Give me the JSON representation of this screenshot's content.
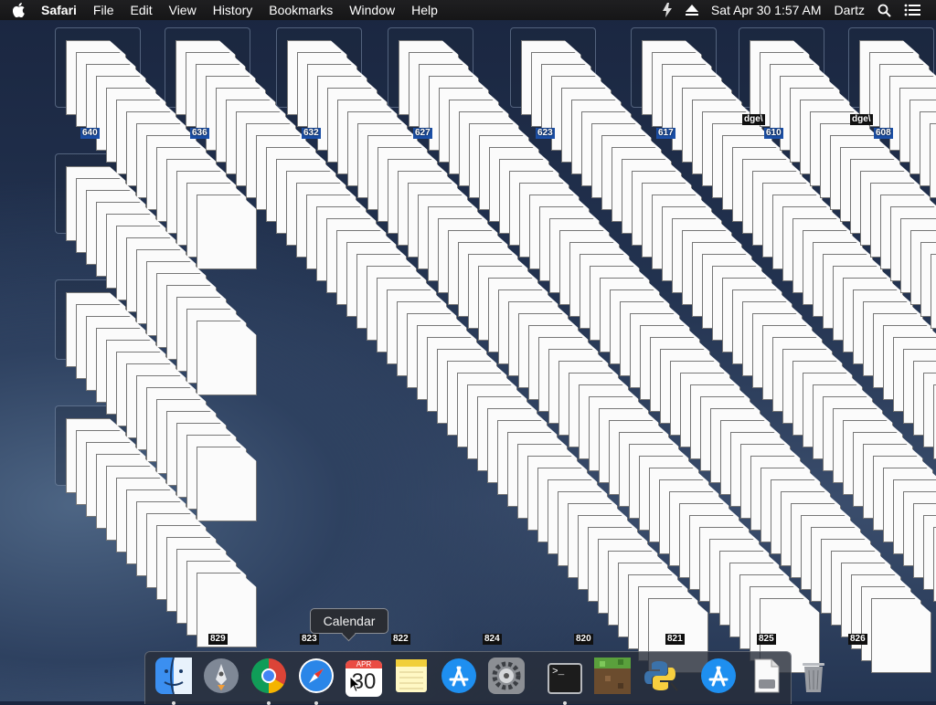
{
  "menubar": {
    "app_name": "Safari",
    "items": [
      "File",
      "Edit",
      "View",
      "History",
      "Bookmarks",
      "Window",
      "Help"
    ],
    "clock": "Sat Apr 30  1:57 AM",
    "user": "Dartz"
  },
  "desktop": {
    "top_row_labels": [
      "640",
      "636",
      "632",
      "627",
      "623",
      "617",
      "610",
      "608"
    ],
    "bottom_row_labels": [
      "829",
      "823",
      "822",
      "824",
      "820",
      "821",
      "825",
      "826"
    ],
    "partial_names": [
      "dge\\",
      "dge\\"
    ]
  },
  "tooltip": {
    "text": "Calendar"
  },
  "dock": {
    "apps": [
      {
        "name": "Finder",
        "icon": "finder-icon",
        "running": true
      },
      {
        "name": "Launchpad",
        "icon": "launchpad-icon",
        "running": false
      },
      {
        "name": "Google Chrome",
        "icon": "chrome-icon",
        "running": true
      },
      {
        "name": "Safari",
        "icon": "safari-icon",
        "running": true
      },
      {
        "name": "Calendar",
        "icon": "calendar-icon",
        "running": false,
        "month": "APR",
        "day": "30"
      },
      {
        "name": "Notes",
        "icon": "notes-icon",
        "running": false
      },
      {
        "name": "App Store",
        "icon": "app-store-icon",
        "running": false
      },
      {
        "name": "System Preferences",
        "icon": "system-preferences-icon",
        "running": false
      },
      {
        "name": "Terminal",
        "icon": "terminal-icon",
        "running": true,
        "prompt": ">_"
      },
      {
        "name": "Minecraft",
        "icon": "minecraft-icon",
        "running": false
      },
      {
        "name": "Python Launcher",
        "icon": "python-icon",
        "running": false
      },
      {
        "name": "Applications",
        "icon": "applications-folder-icon",
        "running": false
      },
      {
        "name": "Downloads",
        "icon": "downloads-icon",
        "running": false
      },
      {
        "name": "Trash",
        "icon": "trash-icon",
        "running": false
      }
    ]
  }
}
